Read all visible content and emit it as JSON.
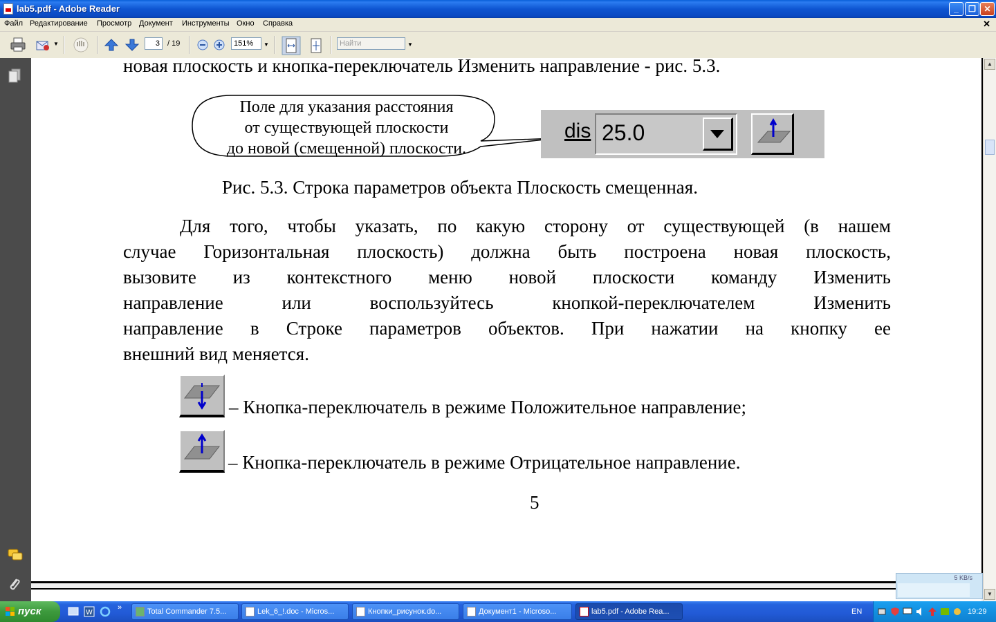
{
  "window": {
    "title": "lab5.pdf - Adobe Reader"
  },
  "menu": [
    "Файл",
    "Редактирование",
    "Просмотр",
    "Документ",
    "Инструменты",
    "Окно",
    "Справка"
  ],
  "toolbar": {
    "page_current": "3",
    "page_total": "/ 19",
    "zoom": "151%",
    "search_placeholder": "Найти"
  },
  "document": {
    "top_line": "новая плоскость и кнопка-переключатель Изменить направление - рис. 5.3.",
    "callout_lines": [
      "Поле для указания расстояния",
      "от существующей плоскости",
      "до новой (смещенной) плоскости."
    ],
    "param_label": "dis",
    "param_value": "25.0",
    "caption": "Рис. 5.3. Строка параметров объекта Плоскость смещенная.",
    "paragraph_lines": [
      "Для того, чтобы указать, по какую сторону от существующей (в нашем",
      "случае Горизонтальная плоскость) должна быть построена новая плоскость,",
      "вызовите из контекстного меню новой плоскости команду Изменить",
      "направление или воспользуйтесь кнопкой-переключателем Изменить",
      "направление в Строке параметров объектов. При нажатии на кнопку ее",
      "внешний вид меняется."
    ],
    "item_positive": "– Кнопка-переключатель в режиме Положительное направление;",
    "item_negative": "– Кнопка-переключатель в режиме Отрицательное направление.",
    "page_number": "5"
  },
  "taskbar": {
    "start_label": "пуск",
    "tasks": [
      "Total Commander 7.5...",
      "Lek_6_!.doc - Micros...",
      "Кнопки_рисунок.do...",
      "Документ1 - Microso...",
      "lab5.pdf - Adobe Rea..."
    ],
    "language": "EN",
    "clock": "19:29"
  },
  "net_widget": {
    "speed": "5 KB/s"
  },
  "colors": {
    "title_blue": "#0a49c2",
    "taskbar_blue": "#225ad6",
    "start_green": "#3d9a3d",
    "nav_dark": "#4b4b4b"
  }
}
